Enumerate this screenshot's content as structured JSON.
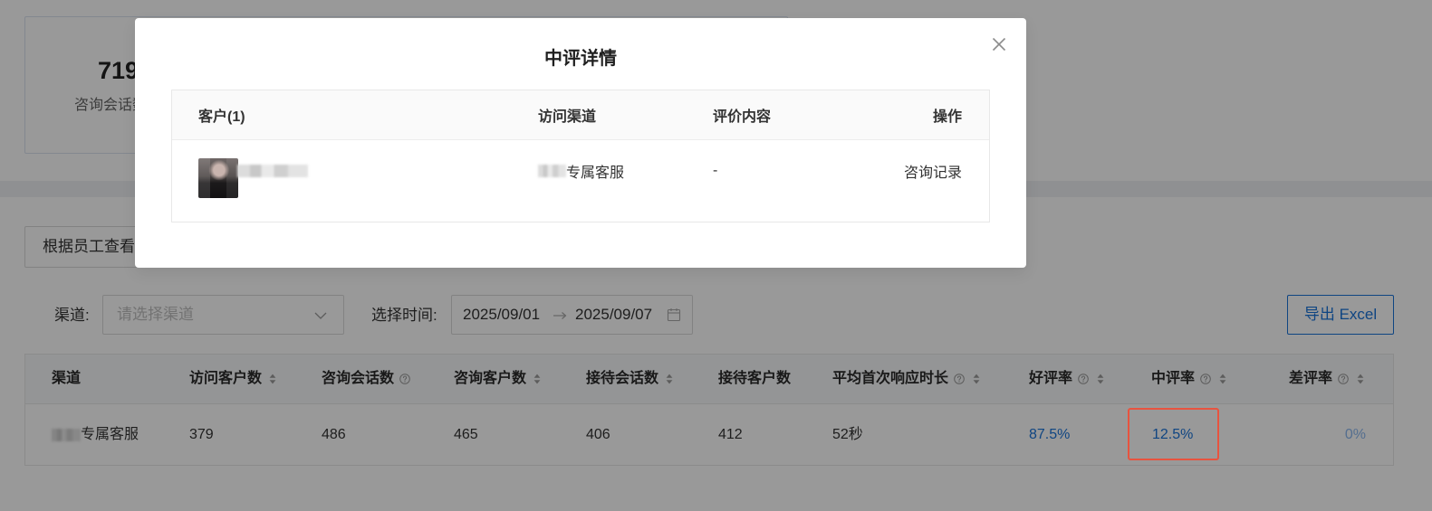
{
  "summary_card": {
    "value": "719",
    "label": "咨询会话数"
  },
  "view_tabs": {
    "by_staff": "根据员工查看"
  },
  "filters": {
    "channel_label": "渠道:",
    "channel_placeholder": "请选择渠道",
    "channel_icon": "chevron-down-icon",
    "time_label": "选择时间:",
    "date_start": "2025/09/01",
    "date_separator_icon": "arrow-right-icon",
    "date_end": "2025/09/07",
    "date_icon": "calendar-icon"
  },
  "toolbar": {
    "export_label": "导出 Excel"
  },
  "stats_table": {
    "columns": [
      {
        "label": "渠道",
        "icons": []
      },
      {
        "label": "访问客户数",
        "icons": [
          "sort-icon"
        ]
      },
      {
        "label": "咨询会话数",
        "icons": [
          "help-icon"
        ]
      },
      {
        "label": "咨询客户数",
        "icons": [
          "sort-icon"
        ]
      },
      {
        "label": "接待会话数",
        "icons": [
          "sort-icon"
        ]
      },
      {
        "label": "接待客户数",
        "icons": []
      },
      {
        "label": "平均首次响应时长",
        "icons": [
          "help-icon",
          "sort-icon"
        ]
      },
      {
        "label": "好评率",
        "icons": [
          "help-icon",
          "sort-icon"
        ]
      },
      {
        "label": "中评率",
        "icons": [
          "help-icon",
          "sort-icon"
        ]
      },
      {
        "label": "差评率",
        "icons": [
          "help-icon",
          "sort-icon"
        ]
      }
    ],
    "rows": [
      {
        "channel": "专属客服",
        "visitor_customers": "379",
        "consult_sessions": "486",
        "consult_customers": "465",
        "reception_sessions": "406",
        "reception_customers": "412",
        "avg_first_response": "52秒",
        "good_rate": "87.5%",
        "neutral_rate": "12.5%",
        "bad_rate": "0%"
      }
    ]
  },
  "review_modal": {
    "title": "中评详情",
    "close_icon": "close-icon",
    "columns": [
      "客户(1)",
      "访问渠道",
      "评价内容",
      "操作"
    ],
    "rows": [
      {
        "channel": "专属客服",
        "review": "-",
        "action": "咨询记录"
      }
    ]
  },
  "colors": {
    "accent": "#1a73d9",
    "link_muted": "#8cb8ee",
    "highlight": "#e8533f",
    "mask": "rgba(0,0,0,0.4)"
  }
}
